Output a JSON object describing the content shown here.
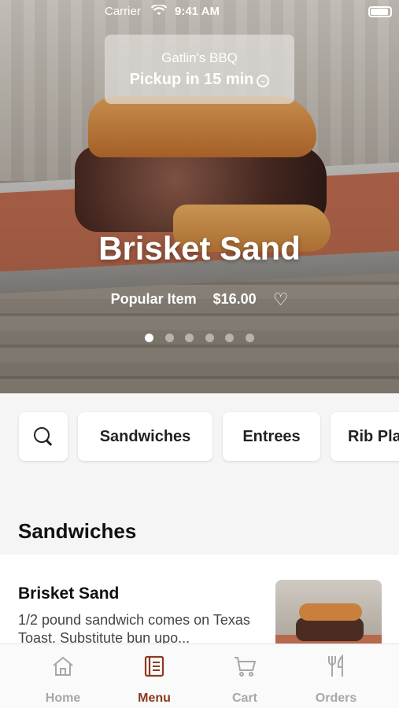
{
  "status_bar": {
    "carrier": "Carrier",
    "time": "9:41 AM"
  },
  "hero": {
    "store_name": "Gatlin's BBQ",
    "pickup_label": "Pickup in 15 min",
    "title": "Brisket Sand",
    "tag": "Popular Item",
    "price": "$16.00",
    "dots_total": 6,
    "dots_active_index": 0
  },
  "categories": {
    "items": [
      "Sandwiches",
      "Entrees",
      "Rib Pla"
    ]
  },
  "section": {
    "title": "Sandwiches"
  },
  "menu_items": [
    {
      "name": "Brisket Sand",
      "description": "1/2 pound sandwich comes on Texas Toast. Substitute bun upo..."
    }
  ],
  "tabbar": {
    "active_color": "#8a3a1f",
    "inactive_color": "#a7a7a7",
    "tabs": [
      {
        "label": "Home",
        "icon": "home-icon"
      },
      {
        "label": "Menu",
        "icon": "menu-book-icon"
      },
      {
        "label": "Cart",
        "icon": "cart-icon"
      },
      {
        "label": "Orders",
        "icon": "fork-knife-icon"
      }
    ],
    "active_index": 1
  }
}
